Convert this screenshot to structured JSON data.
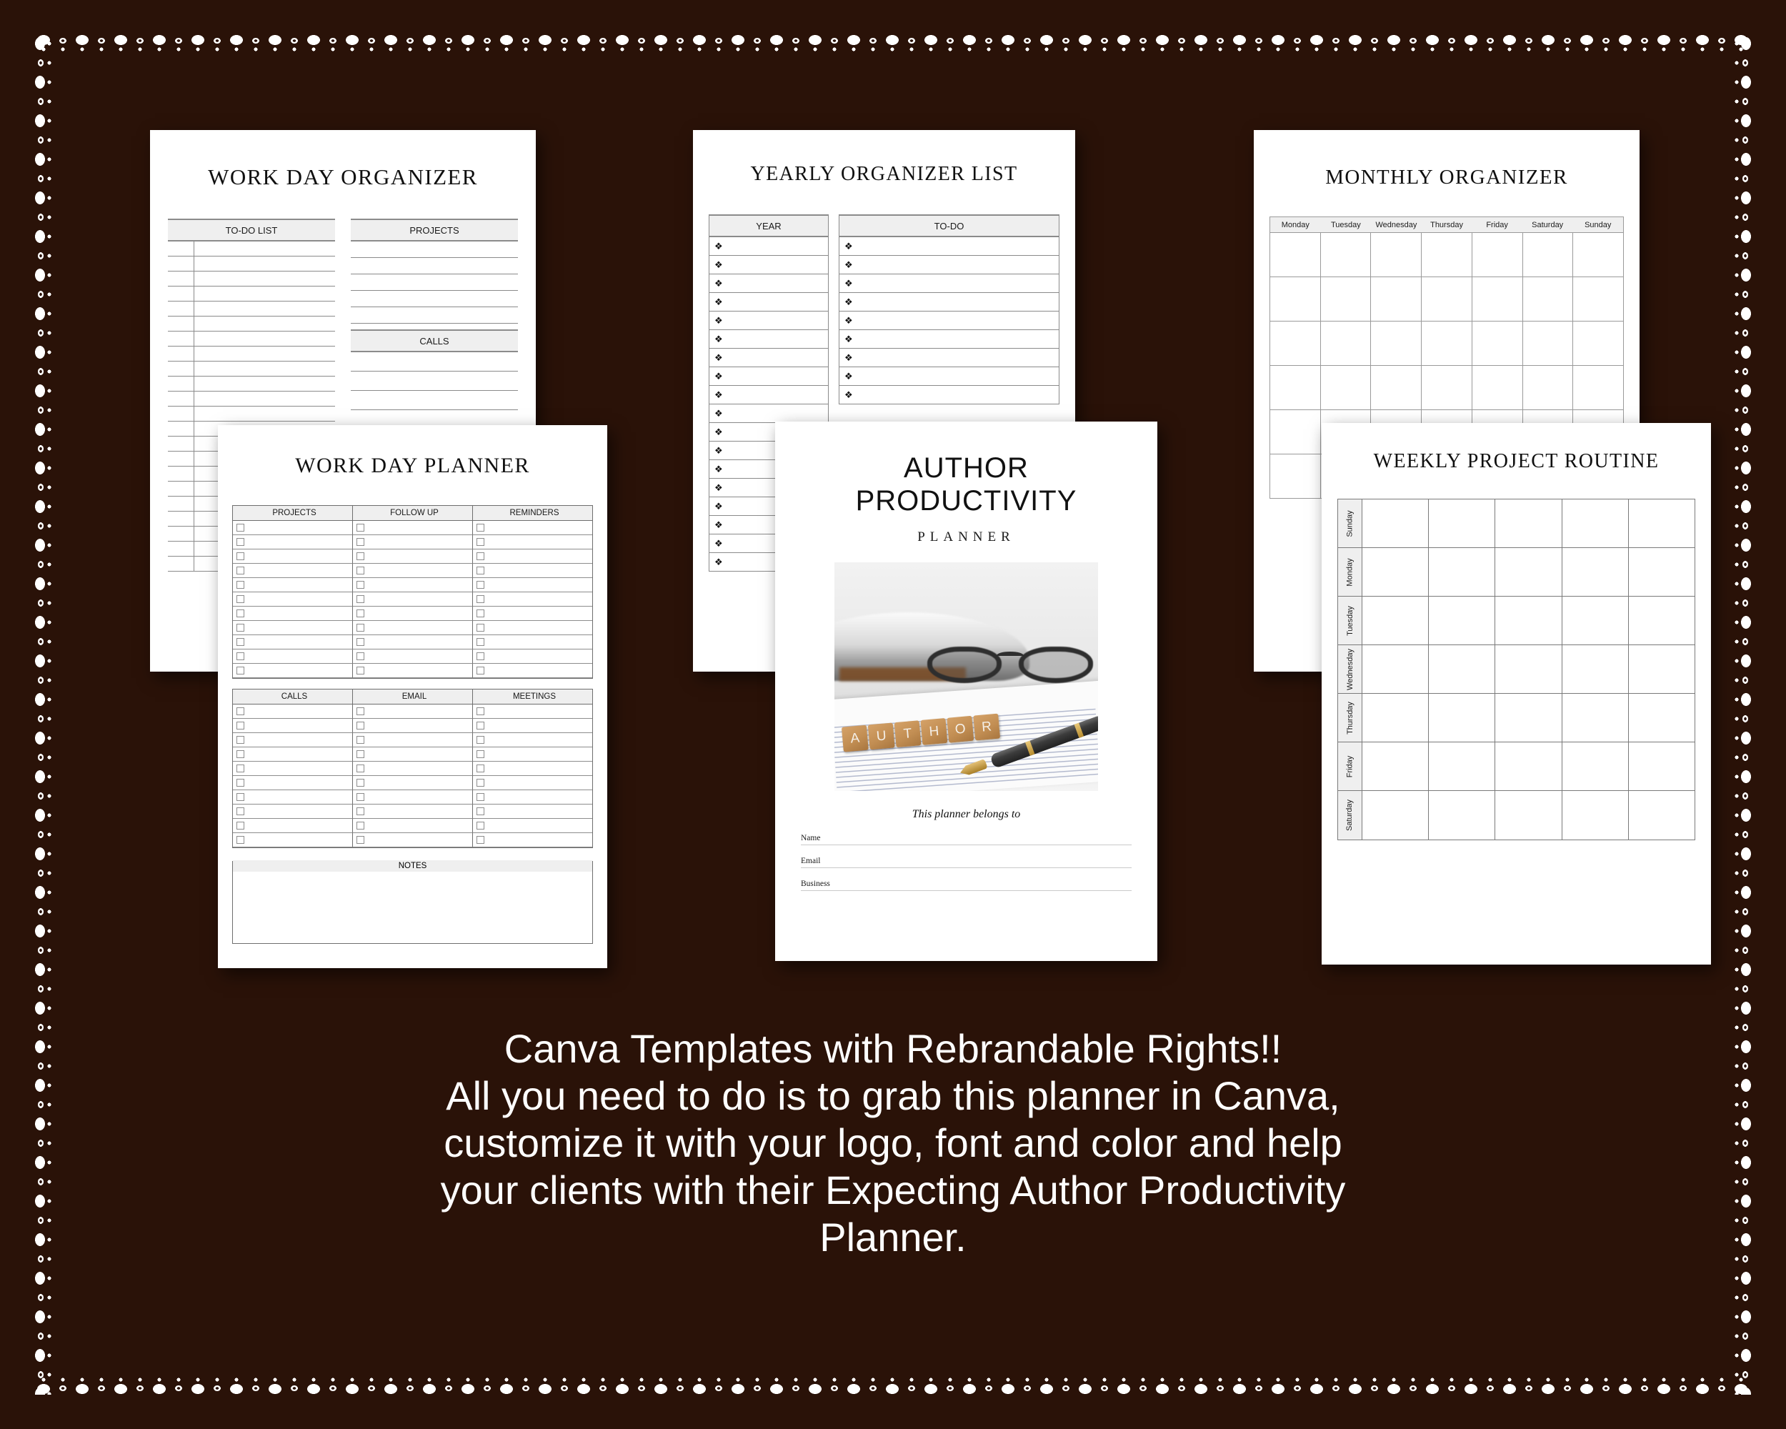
{
  "theme": {
    "background_color": "#2a1208",
    "paper_color": "#ffffff",
    "text_color": "#ffffff",
    "header_fill": "#efefef"
  },
  "pages": {
    "work_day_organizer": {
      "title": "WORK DAY ORGANIZER",
      "left_column_header": "TO-DO LIST",
      "right_column_headers": [
        "PROJECTS",
        "CALLS"
      ],
      "todo_line_count": 22,
      "projects_line_count": 5,
      "calls_line_count": 4
    },
    "yearly_organizer_list": {
      "title": "YEARLY ORGANIZER LIST",
      "columns": [
        "YEAR",
        "TO-DO"
      ],
      "bullet": "❖",
      "year_row_count": 18,
      "todo_row_count": 9
    },
    "monthly_organizer": {
      "title": "MONTHLY ORGANIZER",
      "weekdays": [
        "Monday",
        "Tuesday",
        "Wednesday",
        "Thursday",
        "Friday",
        "Saturday",
        "Sunday"
      ],
      "week_row_count": 6
    },
    "work_day_planner": {
      "title": "WORK DAY PLANNER",
      "top_table_headers": [
        "PROJECTS",
        "FOLLOW UP",
        "REMINDERS"
      ],
      "top_table_rows": 11,
      "bottom_table_headers": [
        "CALLS",
        "EMAIL",
        "MEETINGS"
      ],
      "bottom_table_rows": 10,
      "notes_label": "NOTES"
    },
    "author_productivity_cover": {
      "title_line_1": "AUTHOR",
      "title_line_2": "PRODUCTIVITY",
      "subtitle": "PLANNER",
      "photo_word": "AUTHOR",
      "photo_letters": [
        "A",
        "U",
        "T",
        "H",
        "O",
        "R"
      ],
      "belongs_text": "This planner belongs to",
      "fields": [
        "Name",
        "Email",
        "Business"
      ]
    },
    "weekly_project_routine": {
      "title": "WEEKLY PROJECT ROUTINE",
      "days": [
        "Sunday",
        "Monday",
        "Tuesday",
        "Wednesday",
        "Thursday",
        "Friday",
        "Saturday"
      ],
      "columns_per_day": 5
    }
  },
  "caption": {
    "line1": "Canva Templates with Rebrandable Rights!!",
    "line2": "All you need to do is to grab this planner in Canva,",
    "line3": "customize it with your logo, font and color and help",
    "line4": "your clients with their Expecting Author Productivity",
    "line5": "Planner."
  }
}
